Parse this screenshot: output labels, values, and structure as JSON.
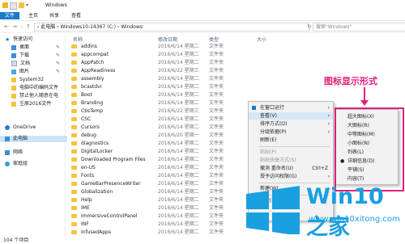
{
  "title": "Windows",
  "ribbon_tabs": [
    "文件",
    "主页",
    "共享",
    "查看"
  ],
  "breadcrumb": "› 此电脑 › Windows10-14367 (C:) › Windows",
  "search_placeholder": "搜索\"Windows\"",
  "sidebar": [
    {
      "label": "快速访问",
      "icon": "star-icon"
    },
    {
      "label": "桌面",
      "icon": "desktop-icon"
    },
    {
      "label": "下载",
      "icon": "download-icon"
    },
    {
      "label": "文档",
      "icon": "document-icon"
    },
    {
      "label": "图片",
      "icon": "picture-icon"
    },
    {
      "label": "System32",
      "icon": "folder-icon"
    },
    {
      "label": "电脑中的编码文件",
      "icon": "folder-icon"
    },
    {
      "label": "禁止他人随意在电",
      "icon": "folder-icon"
    },
    {
      "label": "壬辰2016文件",
      "icon": "folder-icon"
    },
    {
      "label": "OneDrive",
      "icon": "cloud-icon"
    },
    {
      "label": "此电脑",
      "icon": "computer-icon"
    },
    {
      "label": "网络",
      "icon": "network-icon"
    },
    {
      "label": "家庭组",
      "icon": "homegroup-icon"
    }
  ],
  "columns": {
    "name": "名称",
    "date": "修改日期",
    "type": "类型",
    "size": "大小"
  },
  "files": [
    {
      "name": "addins",
      "date": "2016/6/14 星期二",
      "type": "文件夹"
    },
    {
      "name": "appcompat",
      "date": "2016/6/14 星期二",
      "type": "文件夹"
    },
    {
      "name": "AppPatch",
      "date": "2016/6/14 星期二",
      "type": "文件夹"
    },
    {
      "name": "AppReadiness",
      "date": "2016/6/22 星期三",
      "type": "文件夹"
    },
    {
      "name": "assembly",
      "date": "2016/6/14 星期二",
      "type": "文件夹"
    },
    {
      "name": "bcastdvr",
      "date": "2016/6/14 星期二",
      "type": "文件夹"
    },
    {
      "name": "Boot",
      "date": "2016/6/14 星期二",
      "type": "文件夹"
    },
    {
      "name": "Branding",
      "date": "2016/6/14 星期二",
      "type": "文件夹"
    },
    {
      "name": "CbsTemp",
      "date": "2016/6/22 星期三",
      "type": "文件夹"
    },
    {
      "name": "CSC",
      "date": "2016/6/14 星期二",
      "type": "文件夹"
    },
    {
      "name": "Cursors",
      "date": "2016/6/14 星期二",
      "type": "文件夹"
    },
    {
      "name": "debug",
      "date": "2016/6/20 星期一",
      "type": "文件夹"
    },
    {
      "name": "diagnostics",
      "date": "2016/6/14 星期二",
      "type": "文件夹"
    },
    {
      "name": "DigitalLocker",
      "date": "2016/6/14 星期二",
      "type": "文件夹"
    },
    {
      "name": "Downloaded Program Files",
      "date": "2016/6/14 星期二",
      "type": "文件夹"
    },
    {
      "name": "en-US",
      "date": "2016/6/14 星期二",
      "type": "文件夹"
    },
    {
      "name": "Fonts",
      "date": "2016/6/14 星期二",
      "type": "文件夹"
    },
    {
      "name": "GameBarPresenceWriter",
      "date": "2016/6/14 星期二",
      "type": "文件夹"
    },
    {
      "name": "Globalization",
      "date": "2016/6/14 星期二",
      "type": "文件夹"
    },
    {
      "name": "Help",
      "date": "2016/6/14 星期二",
      "type": "文件夹"
    },
    {
      "name": "IME",
      "date": "2016/6/14 星期二",
      "type": "文件夹"
    },
    {
      "name": "ImmersiveControlPanel",
      "date": "2016/6/14 星期二",
      "type": "文件夹"
    },
    {
      "name": "INF",
      "date": "2016/6/14 星期二",
      "type": "文件夹"
    },
    {
      "name": "InfusedApps",
      "date": "2016/6/14 星期二",
      "type": "文件夹"
    }
  ],
  "status": "104 个项目",
  "context_menu": [
    {
      "label": "在窗口运行",
      "arrow": true,
      "icon": "grid-icon"
    },
    {
      "label": "查看(V)",
      "arrow": true,
      "hl": true
    },
    {
      "label": "排序方式(O)",
      "arrow": true
    },
    {
      "label": "分组依据(P)",
      "arrow": true
    },
    {
      "label": "刷新(E)"
    },
    {
      "sep": true
    },
    {
      "label": "粘贴(P)",
      "dis": true
    },
    {
      "label": "粘贴快捷方式(S)",
      "dis": true
    },
    {
      "label": "撤消 重命名(U)",
      "sc": "Ctrl+Z"
    },
    {
      "label": "授予访问权限(G)",
      "arrow": true
    },
    {
      "sep": true
    },
    {
      "label": "新建(W)",
      "arrow": true
    },
    {
      "sep": true
    },
    {
      "label": "属性(R)"
    }
  ],
  "submenu": [
    {
      "label": "超大图标(X)"
    },
    {
      "label": "大图标(R)"
    },
    {
      "label": "中等图标(M)"
    },
    {
      "label": "小图标(N)"
    },
    {
      "label": "列表(L)"
    },
    {
      "label": "详细信息(D)",
      "bullet": true
    },
    {
      "label": "平铺(S)"
    },
    {
      "label": "内容(T)"
    }
  ],
  "annotation": "图标显示形式",
  "watermark": {
    "brand": "Win10 之家",
    "url": "www.win10xitong.com"
  },
  "colors": {
    "accent": "#1979ca",
    "annotation": "#e0207a",
    "watermark": "#1a9fe0",
    "folder": "#f5c342"
  }
}
